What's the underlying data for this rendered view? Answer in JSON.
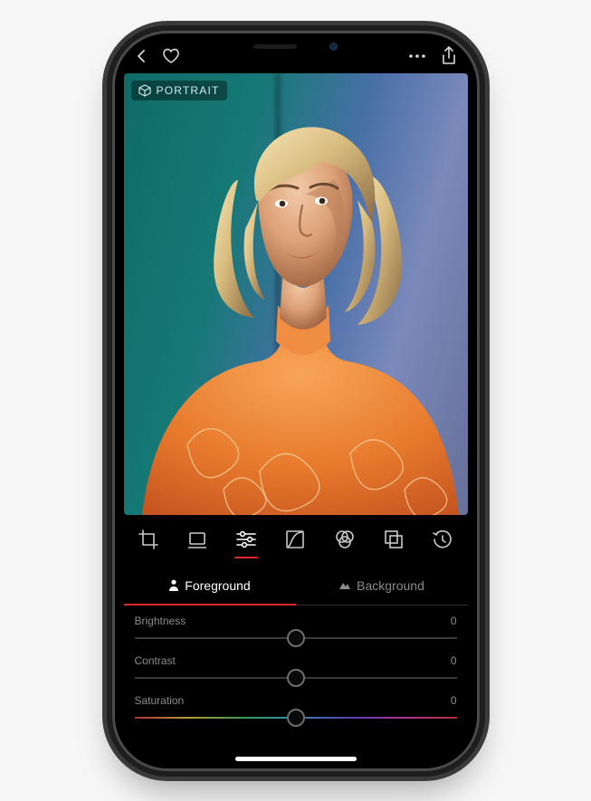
{
  "mode_badge": "PORTRAIT",
  "toolbar": {
    "back": "chevron-left",
    "favorite": "heart",
    "more": "more",
    "share": "share"
  },
  "tools": [
    "crop",
    "presets",
    "adjust",
    "curves",
    "color",
    "overlay",
    "history"
  ],
  "active_tool": "adjust",
  "subtabs": {
    "foreground": {
      "label": "Foreground",
      "icon": "person"
    },
    "background": {
      "label": "Background",
      "icon": "mountain"
    },
    "active": "foreground"
  },
  "sliders": [
    {
      "key": "brightness",
      "label": "Brightness",
      "value": 0,
      "pos": 50
    },
    {
      "key": "contrast",
      "label": "Contrast",
      "value": 0,
      "pos": 50
    },
    {
      "key": "saturation",
      "label": "Saturation",
      "value": 0,
      "pos": 50,
      "hue": true
    }
  ],
  "colors": {
    "accent": "#e02828"
  }
}
